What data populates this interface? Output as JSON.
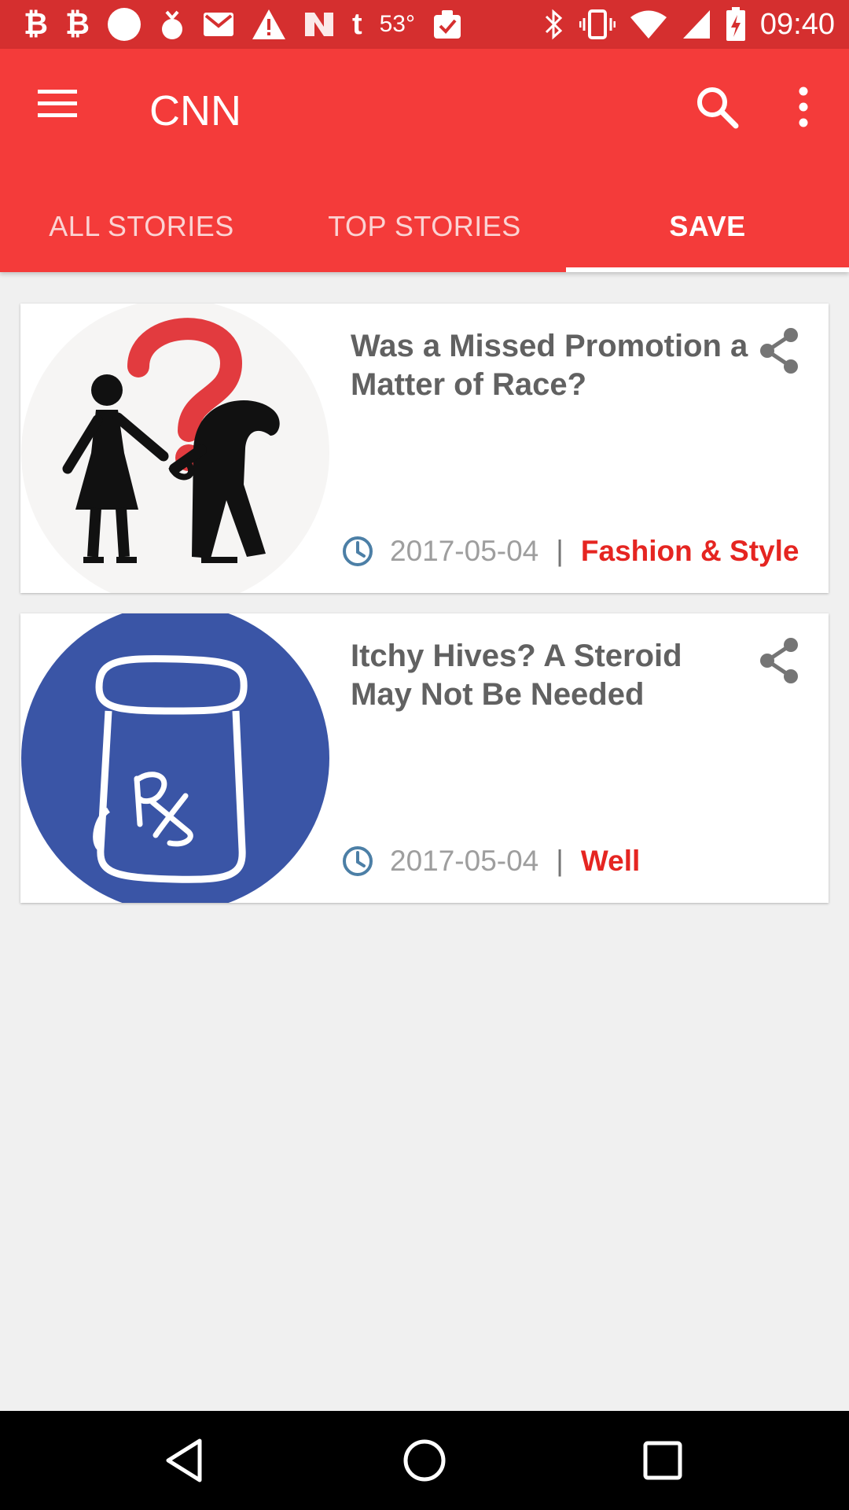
{
  "status_bar": {
    "left_icons": [
      "bitcoin-icon",
      "bitcoin-icon",
      "circle-icon",
      "bomb-icon",
      "gmail-icon",
      "warning-icon",
      "news-icon",
      "tumblr-icon",
      "weather-icon",
      "clipboard-icon"
    ],
    "temperature": "53°",
    "right_icons": [
      "bluetooth-icon",
      "vibrate-icon",
      "wifi-icon",
      "signal-icon",
      "battery-charging-icon"
    ],
    "time": "09:40"
  },
  "app_bar": {
    "title": "CNN",
    "icons": [
      "menu-icon",
      "search-icon",
      "more-vert-icon"
    ]
  },
  "tabs": [
    {
      "label": "ALL STORIES",
      "active": false
    },
    {
      "label": "TOP STORIES",
      "active": false
    },
    {
      "label": "SAVE",
      "active": true
    }
  ],
  "articles": [
    {
      "headline": "Was a Missed Promotion a Matter of Race?",
      "date": "2017-05-04",
      "separator": "|",
      "category": "Fashion & Style",
      "thumbnail": "question-mark-figures-illustration"
    },
    {
      "headline": "Itchy Hives? A Steroid May Not Be Needed",
      "date": "2017-05-04",
      "separator": "|",
      "category": "Well",
      "thumbnail": "prescription-bottle-illustration"
    }
  ],
  "nav_bar": {
    "icons": [
      "back-icon",
      "home-icon",
      "recents-icon"
    ]
  },
  "colors": {
    "status_bar": "#d52f2f",
    "app_bar": "#f43b3a",
    "category": "#e52521",
    "background": "#f0f0f0",
    "thumb_blue": "#3a55a6"
  }
}
